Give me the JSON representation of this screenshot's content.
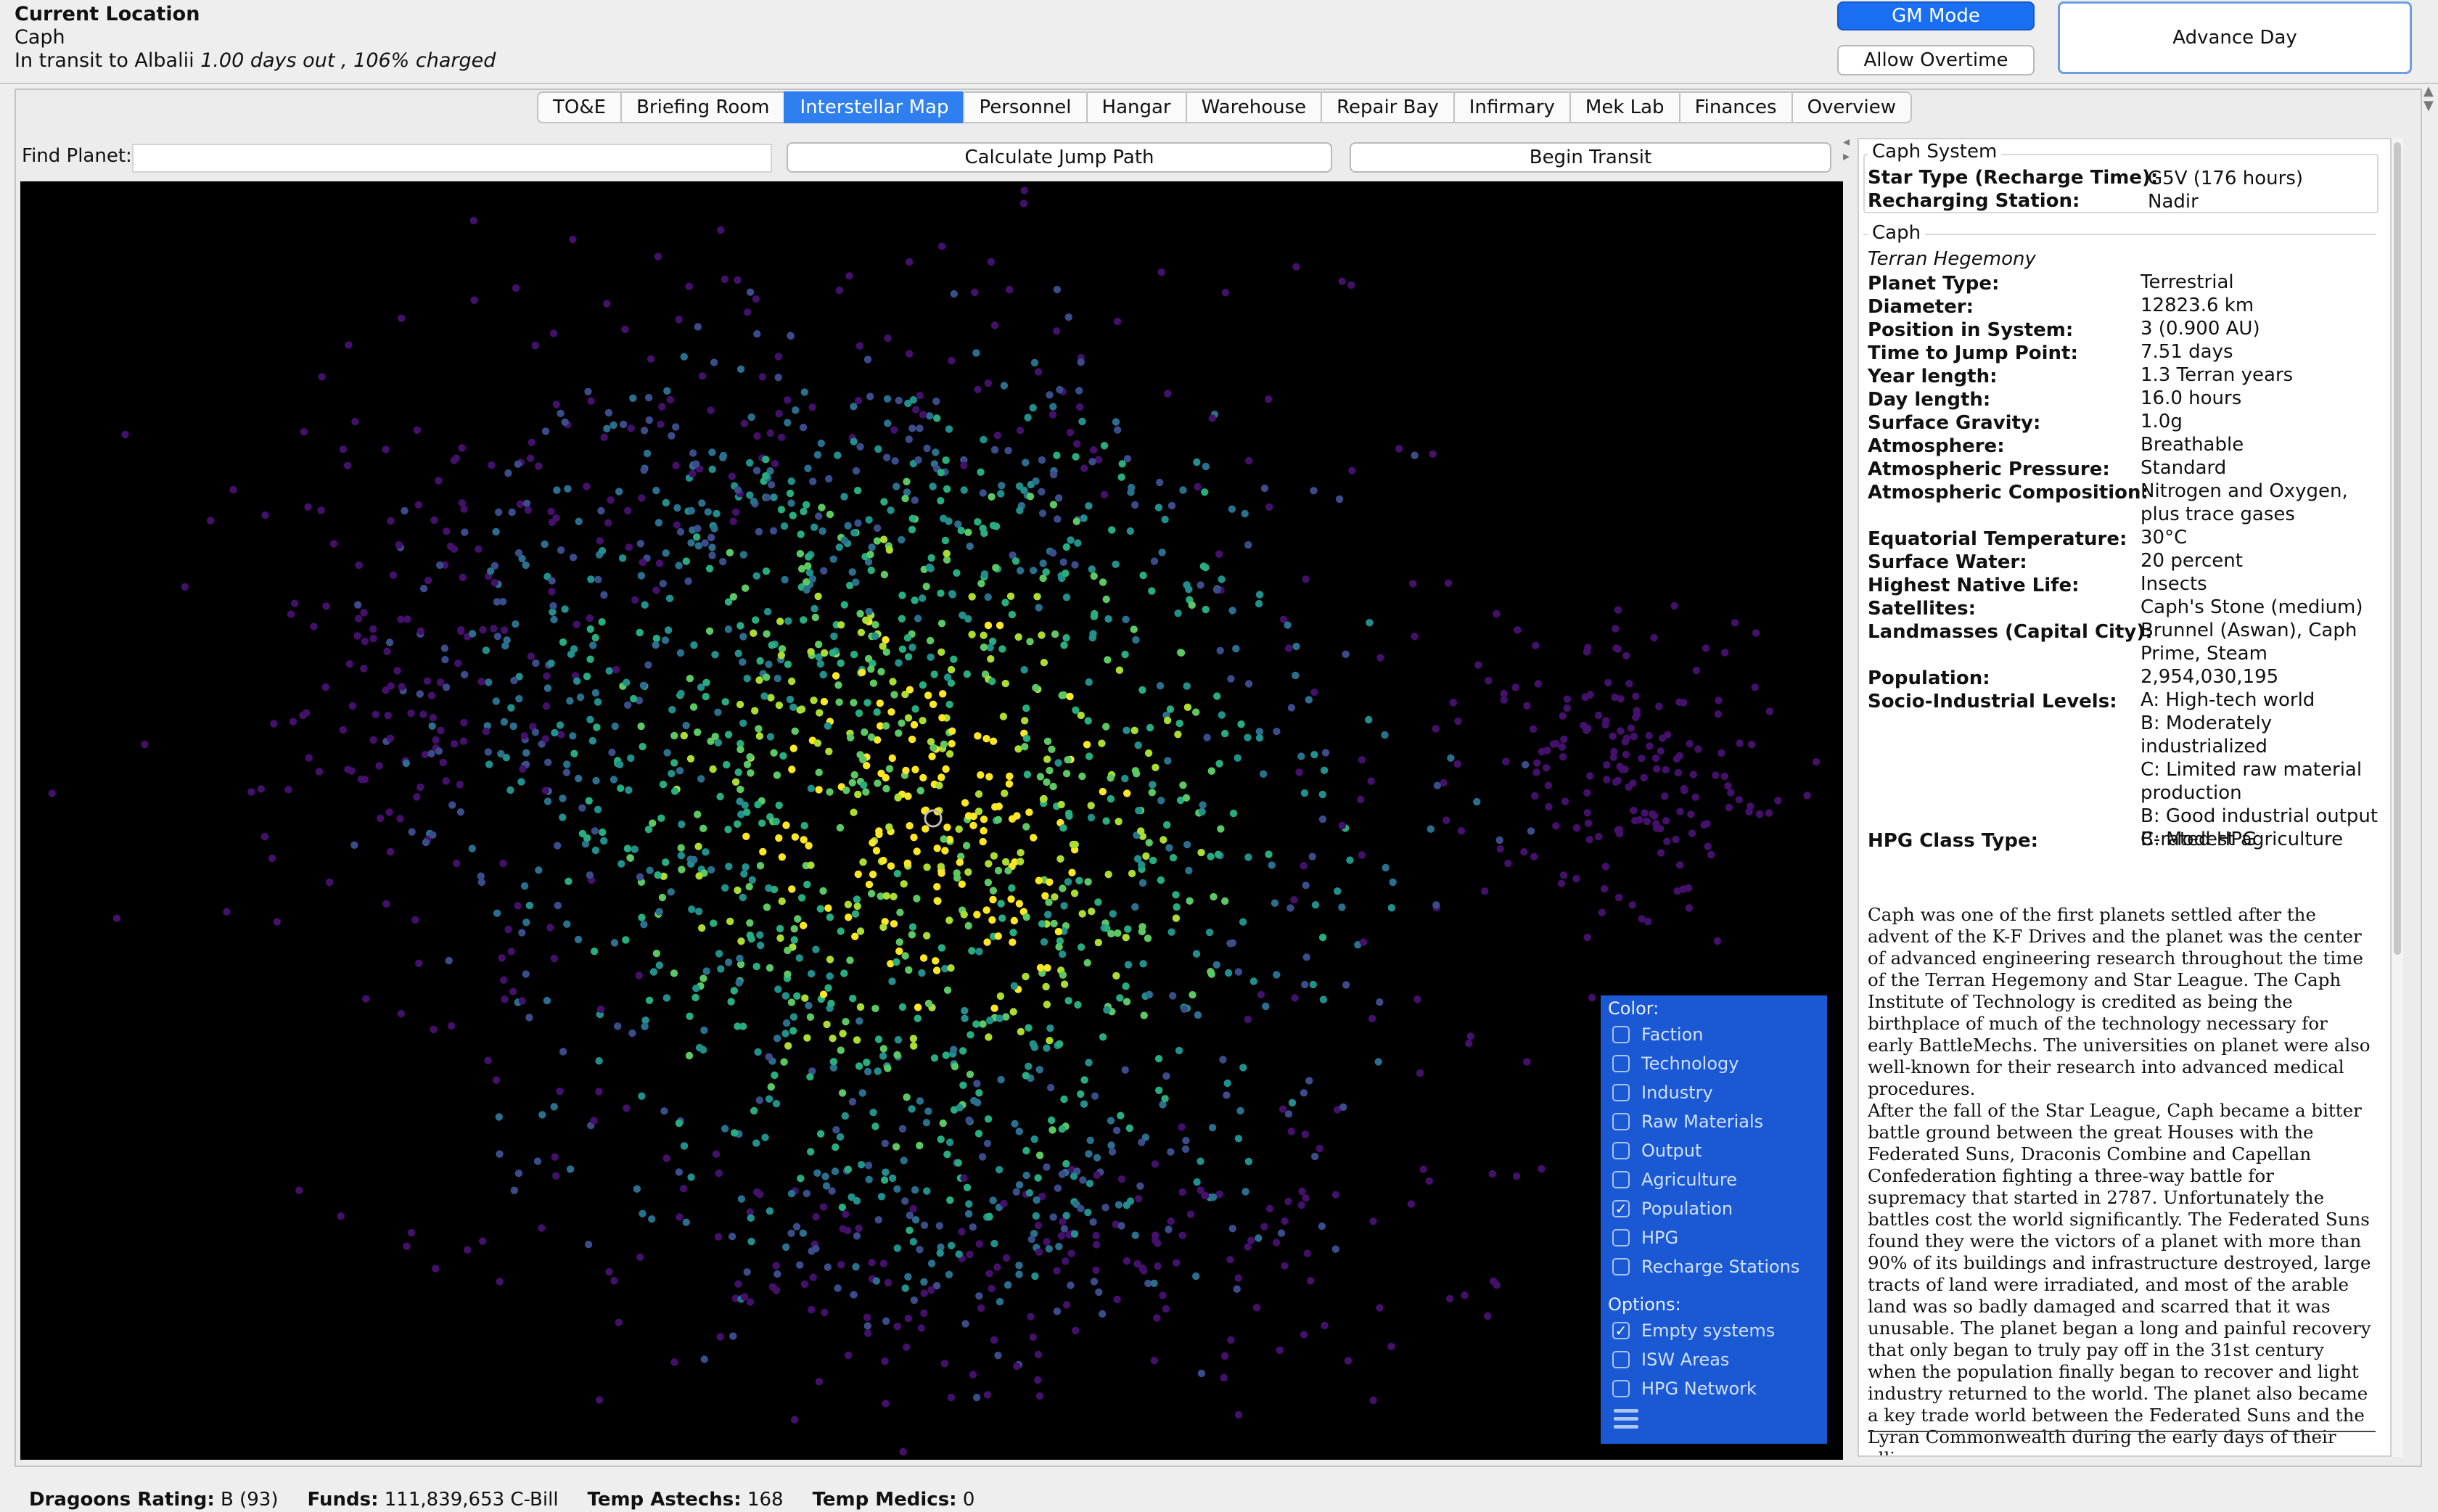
{
  "header": {
    "title": "Current Location",
    "location": "Caph",
    "transit_prefix": "In transit to Albalii ",
    "transit_detail": "1.00 days out , 106% charged"
  },
  "buttons": {
    "gm_mode": "GM Mode",
    "allow_overtime": "Allow Overtime",
    "advance_day": "Advance Day"
  },
  "tabs": [
    {
      "label": "TO&E"
    },
    {
      "label": "Briefing Room"
    },
    {
      "label": "Interstellar Map",
      "active": true
    },
    {
      "label": "Personnel"
    },
    {
      "label": "Hangar"
    },
    {
      "label": "Warehouse"
    },
    {
      "label": "Repair Bay"
    },
    {
      "label": "Infirmary"
    },
    {
      "label": "Mek Lab"
    },
    {
      "label": "Finances"
    },
    {
      "label": "Overview"
    }
  ],
  "toolbar": {
    "find_label": "Find Planet:",
    "find_value": "",
    "calc_jump": "Calculate Jump Path",
    "begin_transit": "Begin Transit"
  },
  "map": {
    "background": "#000000",
    "palette": [
      "#44106c",
      "#3b4c8b",
      "#2b6f8e",
      "#21908d",
      "#27ad80",
      "#5cc863",
      "#aadc32",
      "#fde725"
    ],
    "current_system": "Caph"
  },
  "legend": {
    "color_heading": "Color:",
    "color_items": [
      {
        "label": "Faction",
        "checked": false
      },
      {
        "label": "Technology",
        "checked": false
      },
      {
        "label": "Industry",
        "checked": false
      },
      {
        "label": "Raw Materials",
        "checked": false
      },
      {
        "label": "Output",
        "checked": false
      },
      {
        "label": "Agriculture",
        "checked": false
      },
      {
        "label": "Population",
        "checked": true
      },
      {
        "label": "HPG",
        "checked": false
      },
      {
        "label": "Recharge Stations",
        "checked": false
      }
    ],
    "options_heading": "Options:",
    "option_items": [
      {
        "label": "Empty systems",
        "checked": true
      },
      {
        "label": "ISW Areas",
        "checked": false
      },
      {
        "label": "HPG Network",
        "checked": false
      }
    ]
  },
  "system": {
    "title": "Caph System",
    "star_type_label": "Star Type (Recharge Time):",
    "star_type_value": "G5V (176 hours)",
    "recharging_label": "Recharging Station:",
    "recharging_value": "Nadir"
  },
  "planet": {
    "title": "Caph",
    "faction": "Terran Hegemony",
    "fields": [
      {
        "k": "Planet Type:",
        "v": "Terrestrial"
      },
      {
        "k": "Diameter:",
        "v": "12823.6 km"
      },
      {
        "k": "Position in System:",
        "v": "3 (0.900 AU)"
      },
      {
        "k": "Time to Jump Point:",
        "v": "7.51 days"
      },
      {
        "k": "Year length:",
        "v": "1.3 Terran years"
      },
      {
        "k": "Day length:",
        "v": "16.0 hours"
      },
      {
        "k": "Surface Gravity:",
        "v": "1.0g"
      },
      {
        "k": "Atmosphere:",
        "v": "Breathable"
      },
      {
        "k": "Atmospheric Pressure:",
        "v": "Standard"
      },
      {
        "k": "Atmospheric Composition:",
        "v": "Nitrogen and Oxygen, plus trace gases"
      },
      {
        "k": "Equatorial Temperature:",
        "v": "30°C"
      },
      {
        "k": "Surface Water:",
        "v": "20 percent"
      },
      {
        "k": "Highest Native Life:",
        "v": "Insects"
      },
      {
        "k": "Satellites:",
        "v": "Caph's Stone (medium)"
      },
      {
        "k": "Landmasses (Capital City):",
        "v": "Brunnel (Aswan), Caph Prime, Steam"
      },
      {
        "k": "Population:",
        "v": "2,954,030,195"
      },
      {
        "k": "Socio-Industrial Levels:",
        "v": "A: High-tech world\nB: Moderately industrialized\nC: Limited raw material production\nB: Good industrial output\nC: Modest agriculture"
      },
      {
        "k": "HPG Class Type:",
        "v": "B-rated HPG"
      }
    ],
    "description_1": "Caph was one of the first planets settled after the advent of the K-F Drives and the planet was the center of advanced engineering research throughout the time of the Terran Hegemony and Star League. The Caph Institute of Technology is credited as being the birthplace of much of the technology necessary for early BattleMechs. The universities on planet were also well-known for their research into advanced medical procedures.",
    "description_2": "After the fall of the Star League, Caph became a bitter battle ground between the great Houses with the Federated Suns, Draconis Combine and Capellan Confederation fighting a three-way battle for supremacy that started in 2787. Unfortunately the battles cost the world significantly. The Federated Suns found they were the victors of a planet with more than 90% of its buildings and infrastructure destroyed, large tracts of land were irradiated, and most of the arable land was so badly damaged and scarred that it was unusable. The planet began a long and painful recovery that only began to truly pay off in the 31st century when the population finally began to recover and light industry returned to the world. The planet also became a key trade world between the Federated Suns and the Lyran Commonwealth during the early days of their alliance."
  },
  "status": {
    "rating_label": "Dragoons Rating:",
    "rating_value": "B (93)",
    "funds_label": "Funds:",
    "funds_value": "111,839,653 C-Bill",
    "astechs_label": "Temp Astechs:",
    "astechs_value": "168",
    "medics_label": "Temp Medics:",
    "medics_value": "0"
  }
}
